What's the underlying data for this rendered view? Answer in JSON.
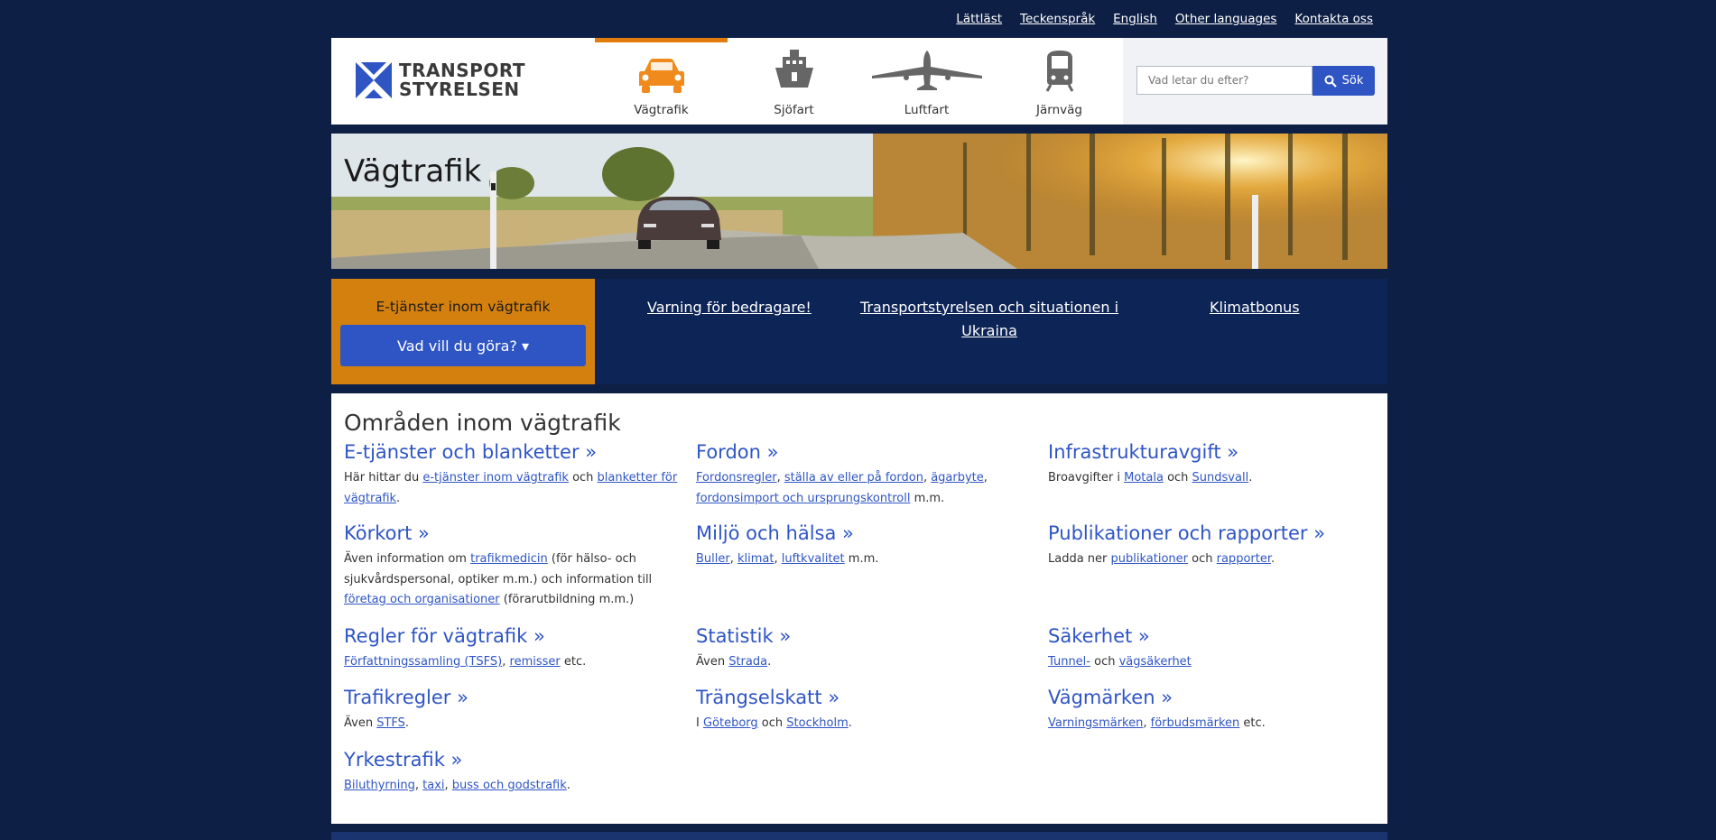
{
  "top_links": [
    "Lättläst",
    "Teckenspråk",
    "English",
    "Other languages",
    "Kontakta oss"
  ],
  "logo": {
    "line1": "TRANSPORT",
    "line2": "STYRELSEN"
  },
  "nav": {
    "items": [
      {
        "label": "Vägtrafik",
        "icon": "car-icon",
        "active": true
      },
      {
        "label": "Sjöfart",
        "icon": "ship-icon",
        "active": false
      },
      {
        "label": "Luftfart",
        "icon": "airplane-icon",
        "active": false
      },
      {
        "label": "Järnväg",
        "icon": "train-icon",
        "active": false
      }
    ]
  },
  "search": {
    "placeholder": "Vad letar du efter?",
    "button_label": "Sök"
  },
  "hero": {
    "title": "Vägtrafik"
  },
  "etjanster": {
    "title": "E-tjänster inom vägtrafik",
    "button_label": "Vad vill du göra? ▾"
  },
  "quick_links": {
    "warning": "Varning för bedragare!",
    "ukraina_line1": "Transportstyrelsen och situationen i",
    "ukraina_line2": "Ukraina",
    "klimatbonus": "Klimatbonus"
  },
  "main": {
    "heading": "Områden inom vägtrafik",
    "areas": [
      {
        "title": "E-tjänster och blanketter »",
        "desc": [
          [
            "Här hittar du ",
            false
          ],
          [
            "e-tjänster inom vägtrafik",
            true
          ],
          [
            " och ",
            false
          ],
          [
            "blanketter för vägtrafik",
            true
          ],
          [
            ".",
            false
          ]
        ]
      },
      {
        "title": "Fordon »",
        "desc": [
          [
            "Fordonsregler",
            true
          ],
          [
            ", ",
            false
          ],
          [
            "ställa av eller på fordon",
            true
          ],
          [
            ", ",
            false
          ],
          [
            "ägarbyte",
            true
          ],
          [
            ", ",
            false
          ],
          [
            "fordonsimport och ursprungskontroll",
            true
          ],
          [
            " m.m.",
            false
          ]
        ]
      },
      {
        "title": "Infrastrukturavgift »",
        "desc": [
          [
            "Broavgifter i ",
            false
          ],
          [
            "Motala",
            true
          ],
          [
            " och ",
            false
          ],
          [
            "Sundsvall",
            true
          ],
          [
            ".",
            false
          ]
        ]
      },
      {
        "title": "Körkort »",
        "desc": [
          [
            "Även information om ",
            false
          ],
          [
            "trafikmedicin",
            true
          ],
          [
            " (för hälso- och sjukvårdspersonal, optiker m.m.) och information till ",
            false
          ],
          [
            "företag och organisationer",
            true
          ],
          [
            " (förarutbildning m.m.)",
            false
          ]
        ]
      },
      {
        "title": "Miljö och hälsa  »",
        "desc": [
          [
            "Buller",
            true
          ],
          [
            ", ",
            false
          ],
          [
            "klimat",
            true
          ],
          [
            ", ",
            false
          ],
          [
            "luftkvalitet",
            true
          ],
          [
            " m.m.",
            false
          ]
        ]
      },
      {
        "title": "Publikationer och rapporter »",
        "desc": [
          [
            "Ladda ner ",
            false
          ],
          [
            "publikationer",
            true
          ],
          [
            " och ",
            false
          ],
          [
            "rapporter",
            true
          ],
          [
            ".",
            false
          ]
        ]
      },
      {
        "title": "Regler för vägtrafik »",
        "desc": [
          [
            "Författningssamling (TSFS)",
            true
          ],
          [
            ", ",
            false
          ],
          [
            "remisser",
            true
          ],
          [
            " etc.",
            false
          ]
        ]
      },
      {
        "title": "Statistik »",
        "desc": [
          [
            "Även ",
            false
          ],
          [
            "Strada",
            true
          ],
          [
            ".",
            false
          ]
        ]
      },
      {
        "title": "Säkerhet »",
        "desc": [
          [
            "Tunnel-",
            true
          ],
          [
            " och ",
            false
          ],
          [
            "vägsäkerhet",
            true
          ]
        ]
      },
      {
        "title": "Trafikregler »",
        "desc": [
          [
            "Även ",
            false
          ],
          [
            "STFS",
            true
          ],
          [
            ".",
            false
          ]
        ]
      },
      {
        "title": "Trängselskatt  »",
        "desc": [
          [
            "I ",
            false
          ],
          [
            "Göteborg",
            true
          ],
          [
            " och ",
            false
          ],
          [
            "Stockholm",
            true
          ],
          [
            ".",
            false
          ]
        ]
      },
      {
        "title": "Vägmärken »",
        "desc": [
          [
            "Varningsmärken",
            true
          ],
          [
            ", ",
            false
          ],
          [
            "förbudsmärken",
            true
          ],
          [
            " etc.",
            false
          ]
        ]
      },
      {
        "title": "Yrkestrafik »",
        "desc": [
          [
            "Biluthyrning",
            true
          ],
          [
            ", ",
            false
          ],
          [
            "taxi",
            true
          ],
          [
            ", ",
            false
          ],
          [
            "buss och godstrafik",
            true
          ],
          [
            ".",
            false
          ]
        ]
      }
    ]
  },
  "colors": {
    "page_bg": "#0d1f45",
    "accent_orange": "#d4800f",
    "link_blue": "#2f55c4",
    "panel_navy": "#0d2456"
  }
}
